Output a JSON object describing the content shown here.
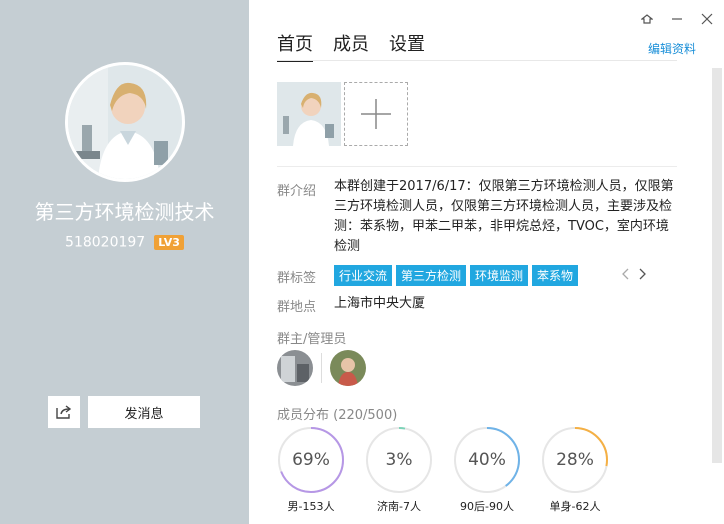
{
  "left": {
    "group_name": "第三方环境检测技术",
    "group_id": "518020197",
    "level": "LV3",
    "send_label": "发消息"
  },
  "tabs": [
    {
      "label": "首页"
    },
    {
      "label": "成员"
    },
    {
      "label": "设置"
    }
  ],
  "edit_link": "编辑资料",
  "intro": {
    "label": "群介绍",
    "value": "本群创建于2017/6/17：仅限第三方环境检测人员，仅限第三方环境检测人员，仅限第三方环境检测人员，主要涉及检测：苯系物，甲苯二甲苯，非甲烷总烃，TVOC，室内环境检测"
  },
  "tags": {
    "label": "群标签",
    "items": [
      "行业交流",
      "第三方检测",
      "环境监测",
      "苯系物"
    ]
  },
  "location": {
    "label": "群地点",
    "value": "上海市中央大厦"
  },
  "admins": {
    "label": "群主/管理员"
  },
  "members": {
    "label": "成员分布 (220/500)",
    "stats": [
      {
        "percent": "69%",
        "label": "男-153人",
        "fraction": 0.69,
        "color": "#b697e6"
      },
      {
        "percent": "3%",
        "label": "济南-7人",
        "fraction": 0.03,
        "color": "#7dd3b8"
      },
      {
        "percent": "40%",
        "label": "90后-90人",
        "fraction": 0.4,
        "color": "#6fb3e8"
      },
      {
        "percent": "28%",
        "label": "单身-62人",
        "fraction": 0.28,
        "color": "#f5b044"
      }
    ]
  }
}
